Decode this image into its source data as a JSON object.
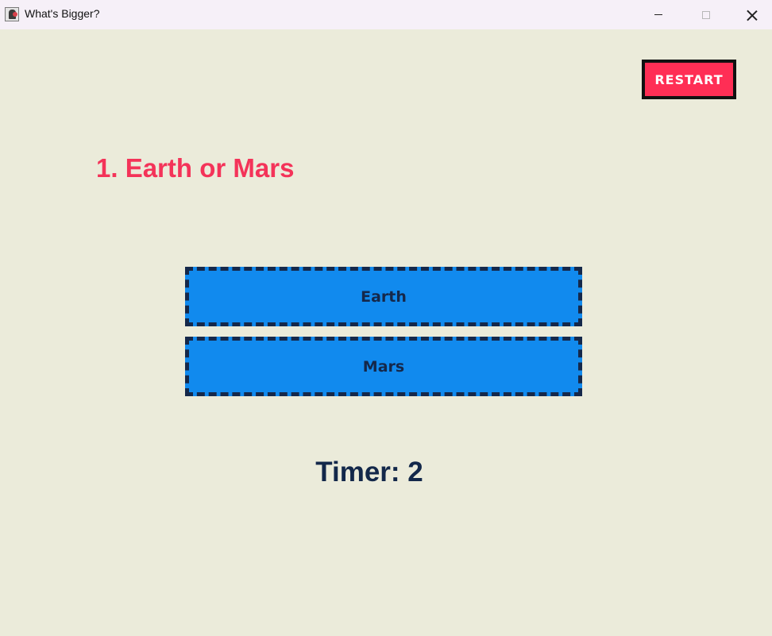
{
  "window": {
    "title": "What's Bigger?",
    "app_icon": "java-app-icon",
    "controls": {
      "minimize_icon": "minimize-icon",
      "maximize_icon": "maximize-icon",
      "close_icon": "close-icon"
    }
  },
  "game": {
    "restart_label": "RESTART",
    "question": "1. Earth or Mars",
    "answers": [
      {
        "label": "Earth"
      },
      {
        "label": "Mars"
      }
    ],
    "timer_text": "Timer: 2"
  },
  "colors": {
    "background": "#ebebda",
    "accent_red": "#f43359",
    "answer_fill": "#118aee",
    "answer_border": "#15284a",
    "timer_text": "#13284a"
  }
}
